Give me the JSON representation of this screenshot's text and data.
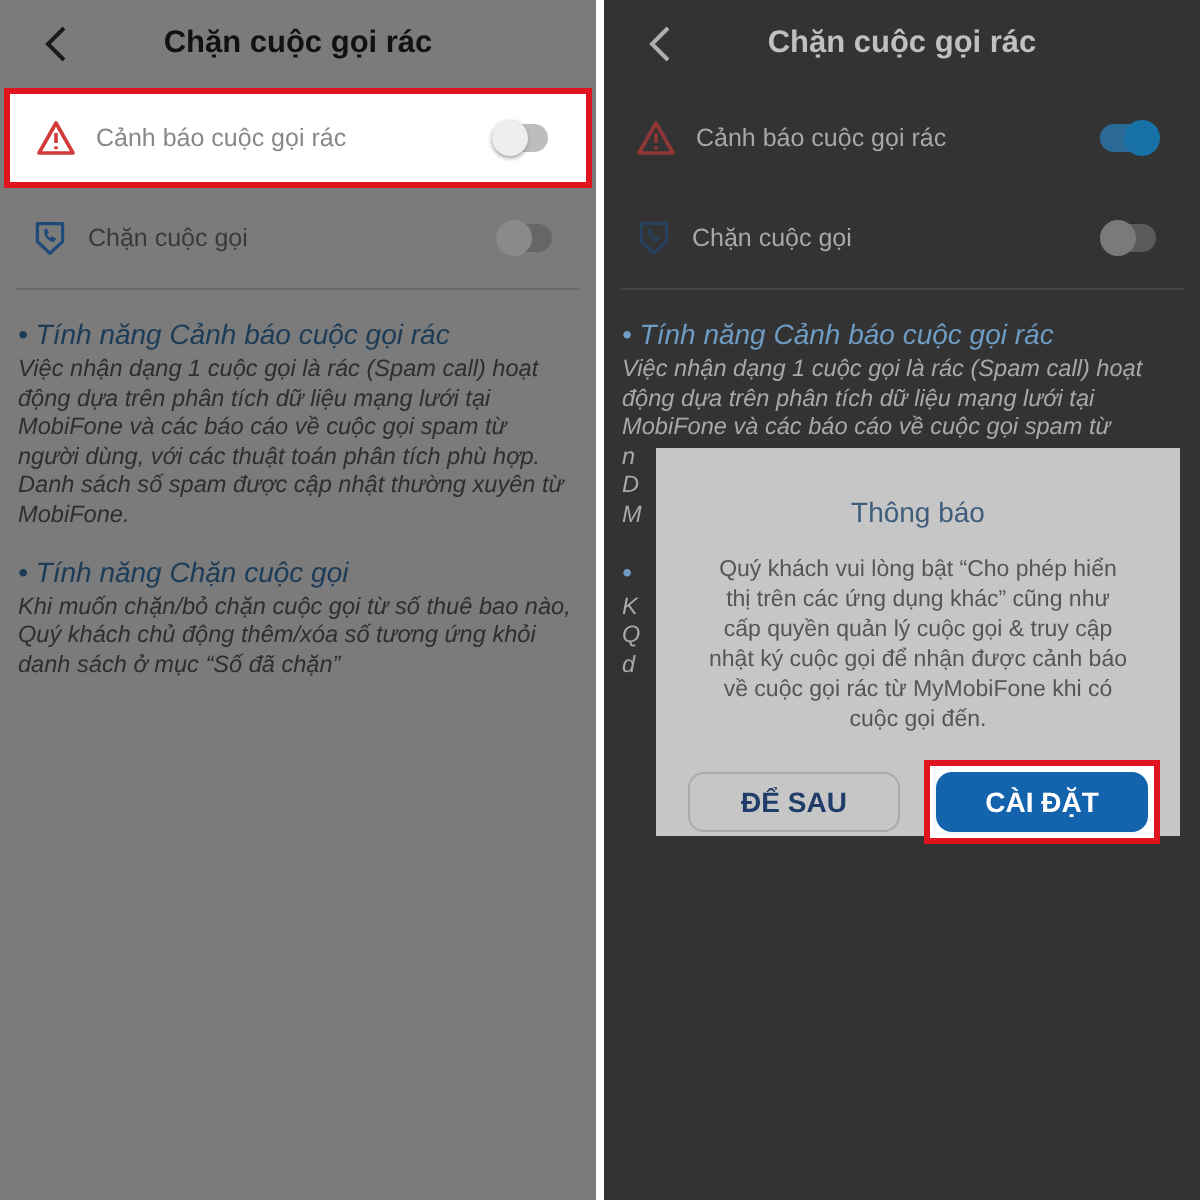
{
  "panels": [
    {
      "title": "Chặn cuộc gọi rác",
      "rows": [
        {
          "label": "Cảnh báo cuộc gọi rác",
          "on": false,
          "highlighted": true
        },
        {
          "label": "Chặn cuộc gọi",
          "on": false,
          "highlighted": false
        }
      ],
      "sections": [
        {
          "heading": "• Tính năng Cảnh báo cuộc gọi rác",
          "lines": [
            "Việc nhận dạng 1 cuộc gọi là rác (Spam call) hoạt",
            "động dựa trên phân tích dữ liệu mạng lưới tại",
            "MobiFone và các báo cáo về cuộc gọi spam từ",
            "người dùng, với các thuật toán phân tích phù hợp.",
            "Danh sách số spam được cập nhật thường xuyên từ",
            "MobiFone."
          ]
        },
        {
          "heading": "• Tính năng Chặn cuộc gọi",
          "lines": [
            "Khi muốn chặn/bỏ chặn cuộc gọi từ số thuê bao nào,",
            "Quý khách chủ động thêm/xóa số tương ứng khỏi",
            "danh sách ở mục “Số đã chặn”"
          ]
        }
      ]
    },
    {
      "title": "Chặn cuộc gọi rác",
      "rows": [
        {
          "label": "Cảnh báo cuộc gọi rác",
          "on": true,
          "highlighted": false
        },
        {
          "label": "Chặn cuộc gọi",
          "on": false,
          "highlighted": false
        }
      ],
      "sections": [
        {
          "heading": "• Tính năng Cảnh báo cuộc gọi rác",
          "lines": [
            "Việc nhận dạng 1 cuộc gọi là rác (Spam call) hoạt",
            "động dựa trên phân tích dữ liệu mạng lưới tại",
            "MobiFone và các báo cáo về cuộc gọi spam từ",
            "n",
            "D",
            "M"
          ]
        },
        {
          "heading": "•",
          "lines": [
            "K",
            "Q",
            "d"
          ]
        }
      ],
      "dialog": {
        "title": "Thông báo",
        "message": "Quý khách vui lòng bật “Cho phép hiển thị trên các ứng dụng khác” cũng như cấp quyền quản lý cuộc gọi & truy cập nhật ký cuộc gọi để nhận được cảnh báo về cuộc gọi rác từ MyMobiFone khi có cuộc gọi đến.",
        "buttons": [
          {
            "label": "ĐỂ SAU",
            "kind": "secondary",
            "highlighted": false
          },
          {
            "label": "CÀI ĐẶT",
            "kind": "primary",
            "highlighted": true
          }
        ]
      }
    }
  ]
}
